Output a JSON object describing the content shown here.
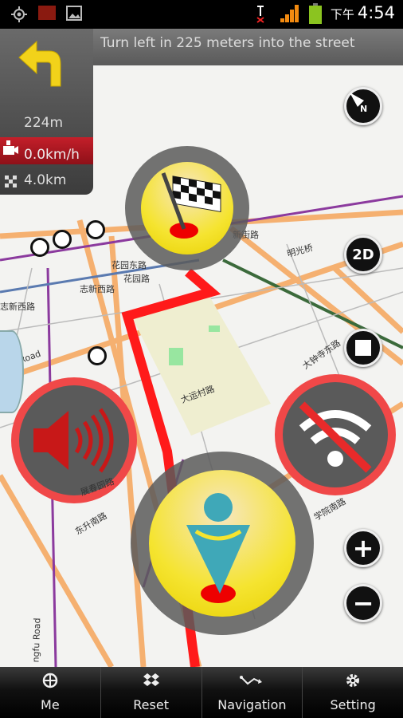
{
  "status_bar": {
    "ampm": "下午",
    "time": "4:54"
  },
  "navigation": {
    "instruction": "Turn left in 225 meters into the street",
    "turn_distance": "224m",
    "speed": "0.0km/h",
    "remaining_distance": "4.0km"
  },
  "map": {
    "labels": [
      "花园东路",
      "花园路",
      "志新西路",
      "志新西路",
      "新街路",
      "明光桥",
      "大钟寺东路",
      "大运村路",
      "展春园路",
      "东升南路",
      "Road",
      "ngfu Road",
      "学院南路"
    ],
    "route_color": "#ff1a1a"
  },
  "controls": {
    "mode_2d": "2D"
  },
  "bottom_tabs": [
    {
      "label": "Me",
      "icon": "crosshair-icon"
    },
    {
      "label": "Reset",
      "icon": "dropbox-icon"
    },
    {
      "label": "Navigation",
      "icon": "route-icon"
    },
    {
      "label": "Setting",
      "icon": "gear-icon"
    }
  ]
}
